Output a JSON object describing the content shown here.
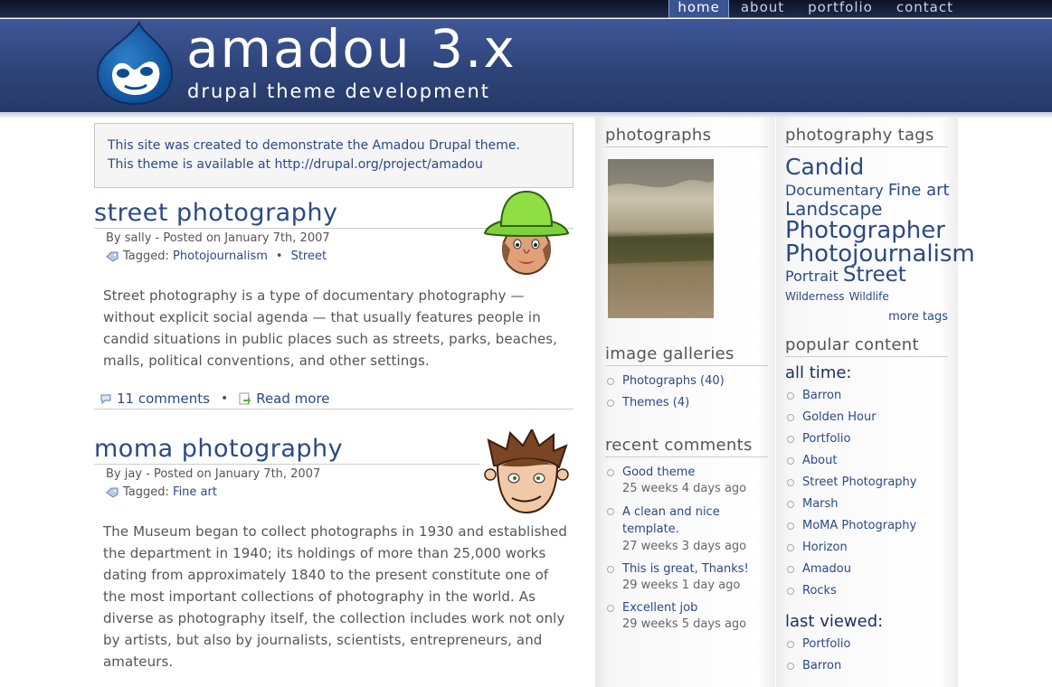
{
  "nav": {
    "items": [
      {
        "label": "home",
        "active": true
      },
      {
        "label": "about"
      },
      {
        "label": "portfolio"
      },
      {
        "label": "contact"
      }
    ]
  },
  "header": {
    "site_name": "amadou 3.x",
    "slogan": "drupal theme development",
    "logo_icon": "drupal-drop-icon"
  },
  "mission": {
    "line1": "This site was created to demonstrate the Amadou Drupal theme.",
    "line2": "This theme is available at http://drupal.org/project/amadou"
  },
  "posts": [
    {
      "title": "street photography",
      "meta": "By sally - Posted on January 7th, 2007",
      "tagged_label": "Tagged:",
      "tags": [
        "Photojournalism",
        "Street"
      ],
      "body": "Street photography is a type of documentary photography — without explicit social agenda — that usually features people in candid situations in public places such as streets, parks, beaches, malls, political conventions, and other settings.",
      "comments_link": "11 comments",
      "read_more": "Read more",
      "avatar": "avatar-green-hat-icon"
    },
    {
      "title": "moma photography",
      "meta": "By jay - Posted on January 7th, 2007",
      "tagged_label": "Tagged:",
      "tags": [
        "Fine art"
      ],
      "body": "The Museum began to collect photographs in 1930 and established the department in 1940; its holdings of more than 25,000 works dating from approximately 1840 to the present constitute one of the most important collections of photography in the world. As diverse as photography itself, the collection includes work not only by artists, but also by journalists, scientists, entrepreneurs, and amateurs.",
      "avatar": "avatar-spiky-hair-icon"
    }
  ],
  "sidebar1": {
    "photographs": {
      "title": "photographs"
    },
    "galleries": {
      "title": "image galleries",
      "items": [
        "Photographs (40)",
        "Themes (4)"
      ]
    },
    "recent_comments": {
      "title": "recent comments",
      "items": [
        {
          "text": "Good theme",
          "age": "25 weeks 4 days ago"
        },
        {
          "text": "A clean and nice template.",
          "age": "27 weeks 3 days ago"
        },
        {
          "text": "This is great, Thanks!",
          "age": "29 weeks 1 day ago"
        },
        {
          "text": "Excellent job",
          "age": "29 weeks 5 days ago"
        }
      ]
    }
  },
  "sidebar2": {
    "tags": {
      "title": "photography tags",
      "cloud": [
        {
          "label": "Candid",
          "weight": 4
        },
        {
          "label": "Documentary",
          "weight": 2
        },
        {
          "label": "Fine art",
          "weight": 3
        },
        {
          "label": "Landscape",
          "weight": 3
        },
        {
          "label": "Photographer",
          "weight": 5
        },
        {
          "label": "Photojournalism",
          "weight": 5
        },
        {
          "label": "Portrait",
          "weight": 2
        },
        {
          "label": "Street",
          "weight": 4
        },
        {
          "label": "Wilderness",
          "weight": 1
        },
        {
          "label": "Wildlife",
          "weight": 1
        }
      ],
      "more": "more tags"
    },
    "popular": {
      "title": "popular content",
      "all_time_label": "all time:",
      "all_time": [
        "Barron",
        "Golden Hour",
        "Portfolio",
        "About",
        "Street Photography",
        "Marsh",
        "MoMA Photography",
        "Horizon",
        "Amadou",
        "Rocks"
      ],
      "last_viewed_label": "last viewed:",
      "last_viewed": [
        "Portfolio",
        "Barron"
      ]
    }
  },
  "colors": {
    "header_bg": "#2e4478",
    "link": "#2b4a85",
    "title": "#283c68"
  }
}
